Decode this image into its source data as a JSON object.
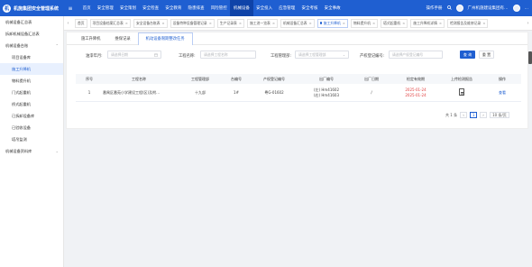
{
  "app": {
    "title": "机施集团安全管理系统",
    "logo_char": "机"
  },
  "topnav": {
    "hamburger": "≡",
    "items": [
      "首页",
      "安全管理",
      "安全策划",
      "安全检查",
      "安全教育",
      "隐患排查",
      "风险管控",
      "机械设备",
      "安全投入",
      "应急管理",
      "安全考核",
      "安全事故"
    ],
    "active_index": 7
  },
  "user": {
    "mode": "操作手册",
    "company": "广州机施建设集团有…",
    "name": "…"
  },
  "sidebar": {
    "items": [
      {
        "label": "机械设备汇总表",
        "type": "item"
      },
      {
        "label": "拆卸机械设备汇总表",
        "type": "item"
      },
      {
        "label": "机械设备台账",
        "type": "group",
        "arrow": "⌃"
      },
      {
        "label": "项目设备库",
        "type": "sub"
      },
      {
        "label": "施工升降机",
        "type": "sub",
        "active": true
      },
      {
        "label": "物料提升机",
        "type": "sub"
      },
      {
        "label": "门式起重机",
        "type": "sub"
      },
      {
        "label": "桥式起重机",
        "type": "sub"
      },
      {
        "label": "已拆卸设备库",
        "type": "sub"
      },
      {
        "label": "已验收设备",
        "type": "sub"
      },
      {
        "label": "塔吊监测",
        "type": "sub"
      },
      {
        "label": "机械设备资料库",
        "type": "group",
        "arrow": "⌄"
      }
    ]
  },
  "tabs": {
    "prev": "‹",
    "next": "›",
    "items": [
      {
        "label": "首页"
      },
      {
        "label": "项目设备档案汇总表"
      },
      {
        "label": "安全设备台账表"
      },
      {
        "label": "设备特种设备管理记录"
      },
      {
        "label": "生产记录表"
      },
      {
        "label": "施工进一览表"
      },
      {
        "label": "机械设备汇总表"
      },
      {
        "label": "施工升降机",
        "active": true
      },
      {
        "label": "物料提升机"
      },
      {
        "label": "塔式起重机"
      },
      {
        "label": "施工升降机详情"
      },
      {
        "label": "检测报告及维修记录"
      }
    ]
  },
  "subtabs": {
    "items": [
      "施工升降机",
      "维保记录",
      "机动设备限期整改任务"
    ],
    "active_index": 2
  },
  "filters": {
    "date_label": "油漆年月:",
    "date_placeholder": "请选择日期",
    "project_label": "工程名称:",
    "project_placeholder": "请选择工程名称",
    "manager_label": "工程管理部:",
    "manager_placeholder": "请选择工程管理部",
    "prop_label": "产权登记编号:",
    "prop_placeholder": "请选择产权登记编号",
    "search_button": "查 询",
    "reset_button": "重 置"
  },
  "table": {
    "columns": [
      "序号",
      "工程名称",
      "工程管理部",
      "台编号",
      "产权登记编号",
      "出厂编号",
      "出厂日期",
      "检定有效期",
      "上传检测报告",
      "操作"
    ],
    "rows": [
      {
        "index": "1",
        "project": "番禺区番苑小学建设工程(区)及附…",
        "dept": "十九部",
        "unit_no": "1#",
        "prop_no": "粤G-01602",
        "factory_no_1": "(左) Hm41602",
        "factory_no_2": "(右) Hm41603",
        "factory_date": "/",
        "valid_1": "2025-01-24",
        "valid_2": "2025-01-24",
        "op": "查看"
      }
    ]
  },
  "pager": {
    "total": "共 1 条",
    "page": "1",
    "size": "10 条/页",
    "prev": "‹",
    "next": "›"
  },
  "icons": {
    "upload": "file-icon",
    "calendar": "calendar-icon",
    "search": "search-icon"
  },
  "colors": {
    "brand": "#1f5fd1",
    "danger": "#e03c3c"
  }
}
